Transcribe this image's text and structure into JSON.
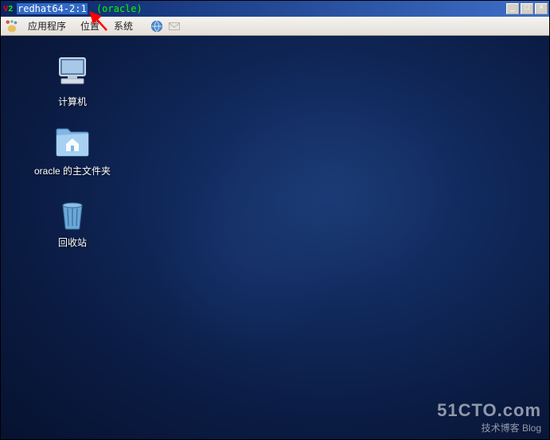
{
  "window": {
    "title_host": "redhat64-2:1",
    "title_user": "(oracle)",
    "minimize": "_",
    "maximize": "□",
    "close": "×"
  },
  "panel": {
    "menus": {
      "applications": "应用程序",
      "places": "位置",
      "system": "系统"
    }
  },
  "desktop": {
    "computer_label": "计算机",
    "home_label": "oracle 的主文件夹",
    "trash_label": "回收站"
  },
  "watermark": {
    "line1": "51CTO.com",
    "line2": "技术博客  Blog"
  }
}
